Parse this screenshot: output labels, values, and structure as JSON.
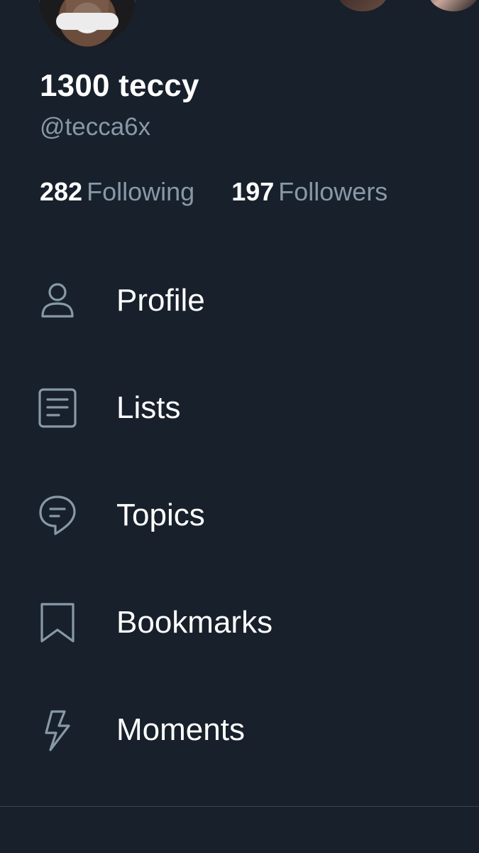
{
  "profile": {
    "display_name": "1300 teccy",
    "handle": "@tecca6x",
    "following_count": "282",
    "following_label": "Following",
    "followers_count": "197",
    "followers_label": "Followers"
  },
  "menu": {
    "items": [
      {
        "label": "Profile",
        "icon": "person-icon"
      },
      {
        "label": "Lists",
        "icon": "list-icon"
      },
      {
        "label": "Topics",
        "icon": "topics-icon"
      },
      {
        "label": "Bookmarks",
        "icon": "bookmark-icon"
      },
      {
        "label": "Moments",
        "icon": "lightning-icon"
      }
    ]
  },
  "colors": {
    "background": "#17202b",
    "text": "#ffffff",
    "secondary_text": "#8899a6",
    "icon": "#8899a6",
    "divider": "#38444d"
  }
}
